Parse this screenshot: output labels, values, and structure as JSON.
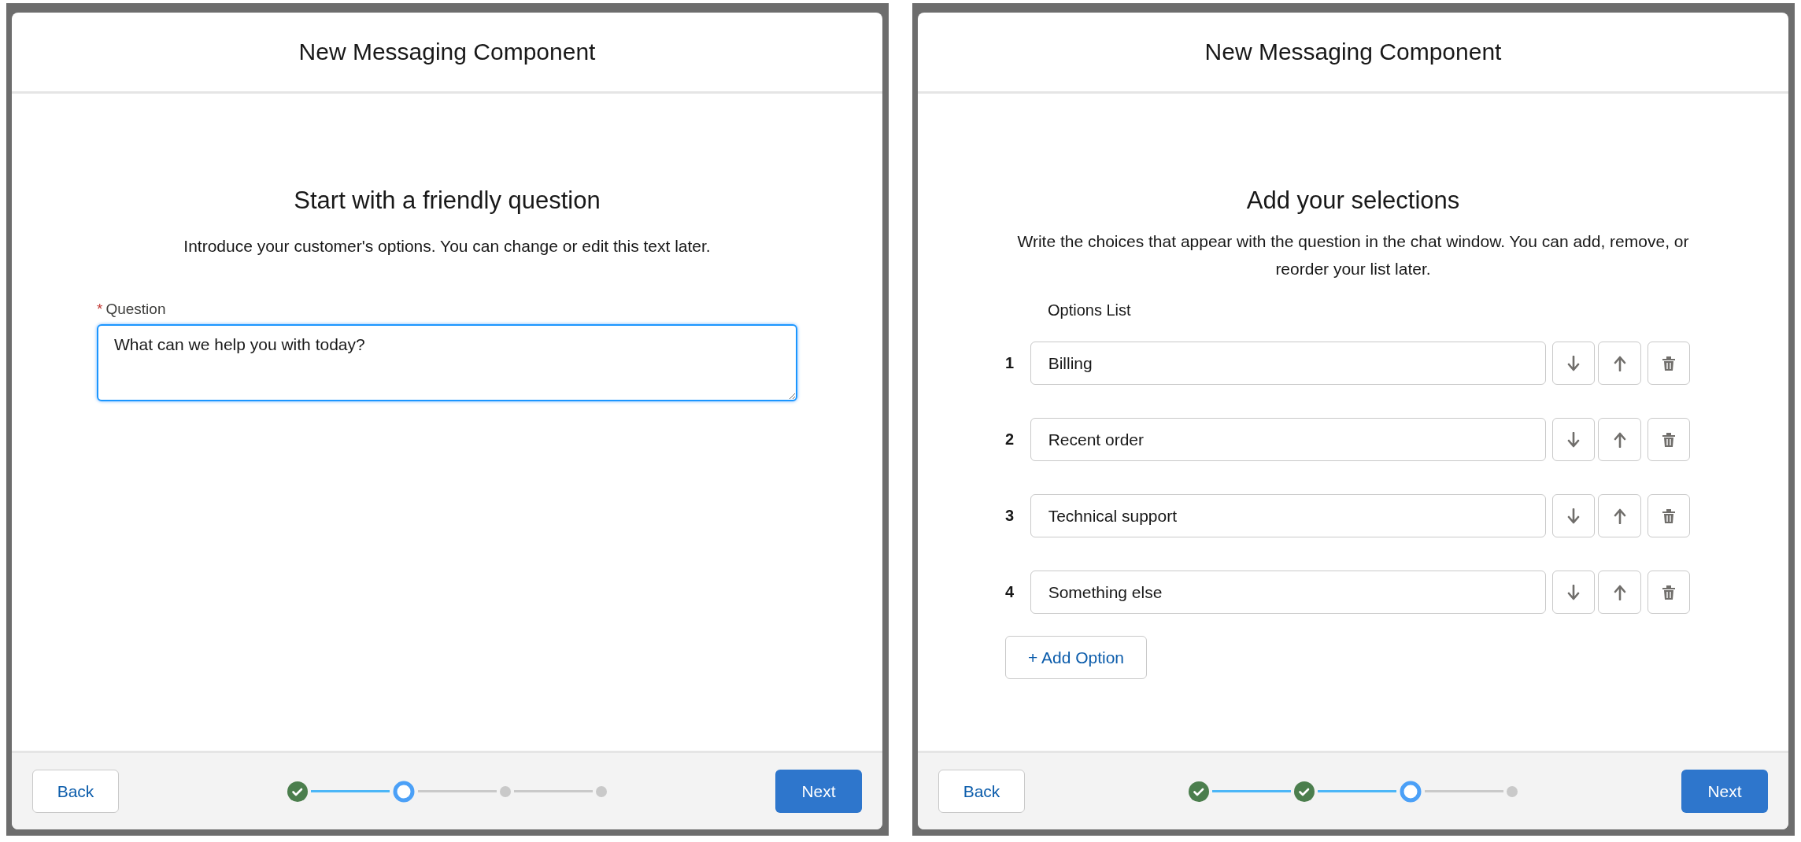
{
  "panels": [
    {
      "modal": {
        "title": "New Messaging Component",
        "heading": "Start with a friendly question",
        "description": "Introduce your customer's options. You can change or edit this text later.",
        "kind": "question",
        "field": {
          "label": "Question",
          "required_mark": "*",
          "value": "What can we help you with today?",
          "focused": true
        },
        "footer": {
          "back": "Back",
          "next": "Next",
          "steps": [
            {
              "kind": "complete"
            },
            {
              "kind": "current"
            },
            {
              "kind": "upcoming"
            },
            {
              "kind": "upcoming"
            }
          ]
        }
      }
    },
    {
      "modal": {
        "title": "New Messaging Component",
        "heading": "Add your selections",
        "description": "Write the choices that appear with the question in the chat window. You can add, remove, or reorder your list later.",
        "kind": "options",
        "list_label": "Options List",
        "options": [
          {
            "number": "1",
            "value": "Billing"
          },
          {
            "number": "2",
            "value": "Recent order"
          },
          {
            "number": "3",
            "value": "Technical support"
          },
          {
            "number": "4",
            "value": "Something else"
          }
        ],
        "add_button": "+ Add Option",
        "footer": {
          "back": "Back",
          "next": "Next",
          "steps": [
            {
              "kind": "complete"
            },
            {
              "kind": "complete"
            },
            {
              "kind": "current"
            },
            {
              "kind": "upcoming"
            }
          ]
        }
      }
    }
  ]
}
